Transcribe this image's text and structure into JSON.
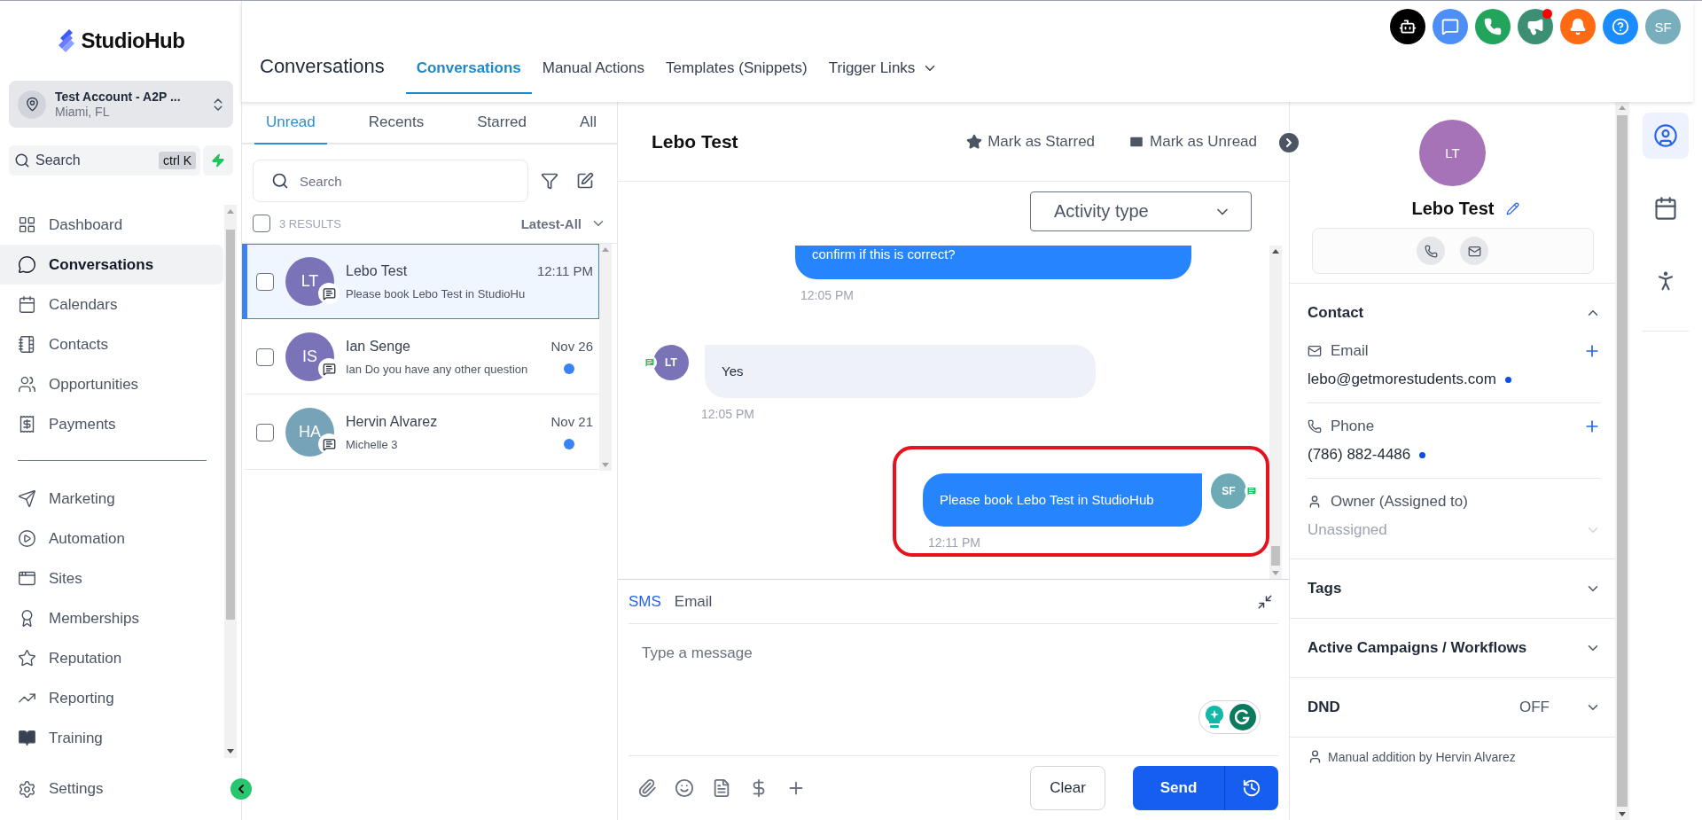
{
  "sidebar": {
    "logo": "StudioHub",
    "account": {
      "name": "Test Account - A2P ...",
      "location": "Miami, FL"
    },
    "search": {
      "placeholder": "Search",
      "shortcut": "ctrl K"
    },
    "nav": [
      {
        "kind": "dashboard",
        "label": "Dashboard",
        "selected": false
      },
      {
        "kind": "conversations",
        "label": "Conversations",
        "selected": true
      },
      {
        "kind": "calendars",
        "label": "Calendars",
        "selected": false
      },
      {
        "kind": "contacts",
        "label": "Contacts",
        "selected": false
      },
      {
        "kind": "opportunities",
        "label": "Opportunities",
        "selected": false
      },
      {
        "kind": "payments",
        "label": "Payments",
        "selected": false
      }
    ],
    "nav_secondary": [
      {
        "kind": "marketing",
        "label": "Marketing",
        "selected": false
      },
      {
        "kind": "automation",
        "label": "Automation",
        "selected": false
      },
      {
        "kind": "sites",
        "label": "Sites",
        "selected": false
      },
      {
        "kind": "memberships",
        "label": "Memberships",
        "selected": false
      },
      {
        "kind": "reputation",
        "label": "Reputation",
        "selected": false
      },
      {
        "kind": "reporting",
        "label": "Reporting",
        "selected": false
      },
      {
        "kind": "training",
        "label": "Training",
        "selected": false
      }
    ],
    "settings": {
      "label": "Settings"
    }
  },
  "header": {
    "title": "Conversations",
    "tabs": [
      {
        "label": "Conversations",
        "selected": true,
        "dropdown": false
      },
      {
        "label": "Manual Actions",
        "selected": false,
        "dropdown": false
      },
      {
        "label": "Templates (Snippets)",
        "selected": false,
        "dropdown": false
      },
      {
        "label": "Trigger Links",
        "selected": false,
        "dropdown": true
      }
    ],
    "top_icons": [
      {
        "kind": "bot",
        "color": "#000000",
        "badge": false
      },
      {
        "kind": "chat",
        "color": "#4d8ef7",
        "badge": false
      },
      {
        "kind": "phone",
        "color": "#22a45d",
        "badge": false
      },
      {
        "kind": "megaphone",
        "color": "#3d8f73",
        "badge": true
      },
      {
        "kind": "bell",
        "color": "#ff6a13",
        "badge": false
      },
      {
        "kind": "help",
        "color": "#1a8cff",
        "badge": false
      }
    ],
    "user": {
      "initials": "SF",
      "color": "#79aebd"
    }
  },
  "conversation_list": {
    "tabs": [
      {
        "label": "Unread",
        "selected": true
      },
      {
        "label": "Recents",
        "selected": false
      },
      {
        "label": "Starred",
        "selected": false
      },
      {
        "label": "All",
        "selected": false
      }
    ],
    "search": {
      "placeholder": "Search"
    },
    "all_selected": false,
    "results": "3 RESULTS",
    "sort": "Latest-All",
    "conversations": [
      {
        "initials": "LT",
        "color": "#7a73b8",
        "name": "Lebo Test",
        "preview": "Please book Lebo Test in StudioHu",
        "time": "12:11 PM",
        "selected": true,
        "unread": false
      },
      {
        "initials": "IS",
        "color": "#7a73b8",
        "name": "Ian Senge",
        "preview": "Ian Do you have any other question",
        "time": "Nov 26",
        "selected": false,
        "unread": true
      },
      {
        "initials": "HA",
        "color": "#76a3b8",
        "name": "Hervin Alvarez",
        "preview": "Michelle 3",
        "time": "Nov 21",
        "selected": false,
        "unread": true
      }
    ]
  },
  "chat": {
    "contact_name": "Lebo Test",
    "actions": [
      {
        "kind": "star",
        "label": "Mark as Starred"
      },
      {
        "kind": "mail",
        "label": "Mark as Unread"
      }
    ],
    "activity_filter": {
      "placeholder": "Activity type"
    },
    "messages": [
      {
        "outgoing": true,
        "text": "confirm if this is correct?",
        "time": "12:05 PM",
        "clipped": true,
        "highlighted": false
      },
      {
        "outgoing": false,
        "initials": "LT",
        "color": "#7a73b8",
        "text": "Yes",
        "time": "12:05 PM",
        "clipped": false,
        "highlighted": false
      },
      {
        "outgoing": true,
        "initials": "SF",
        "color": "#6daab5",
        "text": "Please book Lebo Test in StudioHub",
        "time": "12:11 PM",
        "clipped": false,
        "highlighted": true
      }
    ],
    "composer": {
      "channels": [
        {
          "label": "SMS",
          "selected": true
        },
        {
          "label": "Email",
          "selected": false
        }
      ],
      "placeholder": "Type a message",
      "clear": "Clear",
      "send": "Send"
    }
  },
  "contact_panel": {
    "initials": "LT",
    "color": "#a673b8",
    "name": "Lebo Test",
    "contact_section": {
      "title": "Contact",
      "expanded": true,
      "fields": [
        {
          "kind": "email",
          "label": "Email",
          "value": "lebo@getmorestudents.com",
          "dot": true
        },
        {
          "kind": "phone",
          "label": "Phone",
          "value": "(786) 882-4486",
          "dot": true
        },
        {
          "kind": "owner",
          "label": "Owner (Assigned to)",
          "placeholder": "Unassigned"
        }
      ]
    },
    "sections": [
      {
        "title": "Tags",
        "expanded": false
      },
      {
        "title": "Active Campaigns / Workflows",
        "expanded": false
      },
      {
        "title": "DND",
        "value": "OFF",
        "expanded": false
      }
    ],
    "footer": "Manual addition by Hervin Alvarez"
  },
  "rail": [
    {
      "kind": "contact",
      "selected": true
    },
    {
      "kind": "calendar",
      "selected": false
    },
    {
      "kind": "people",
      "selected": false
    }
  ]
}
